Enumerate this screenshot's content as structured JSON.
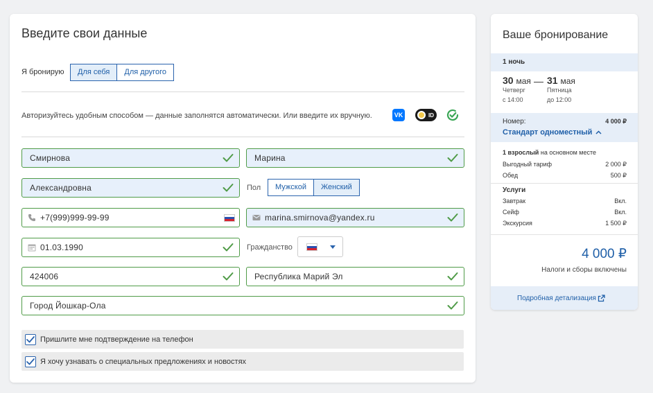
{
  "form": {
    "title": "Введите свои данные",
    "booking_for_label": "Я бронирую",
    "booking_for_options": [
      "Для себя",
      "Для другого"
    ],
    "booking_for_selected": "Для себя",
    "auth_text": "Авторизуйтесь удобным способом — данные заполнятся автоматически. Или введите их вручную.",
    "auth_providers": {
      "vk_label": "VK",
      "id_label": "ID"
    },
    "last_name": "Смирнова",
    "first_name": "Марина",
    "middle_name": "Александровна",
    "gender_label": "Пол",
    "gender_options": [
      "Мужской",
      "Женский"
    ],
    "gender_selected": "Женский",
    "phone": "+7(999)999-99-99",
    "email": "marina.smirnova@yandex.ru",
    "birth_date": "01.03.1990",
    "citizenship_label": "Гражданство",
    "postal_code": "424006",
    "region": "Республика Марий Эл",
    "city": "Город Йошкар-Ола",
    "checkbox_phone_confirm": "Пришлите мне подтверждение на телефон",
    "checkbox_offers": "Я хочу узнавать о специальных предложениях и новостях",
    "checkbox_phone_confirm_checked": true,
    "checkbox_offers_checked": true
  },
  "booking": {
    "title": "Ваше бронирование",
    "nights": "1 ночь",
    "checkin_day": "30",
    "checkin_month": "мая",
    "checkin_weekday": "Четверг",
    "checkin_time": "с 14:00",
    "checkout_day": "31",
    "checkout_month": "мая",
    "checkout_weekday": "Пятница",
    "checkout_time": "до 12:00",
    "date_separator": "—",
    "room_label": "Номер:",
    "room_price": "4 000 ₽",
    "room_name": "Стандарт одноместный",
    "guests_bold": "1 взрослый",
    "guests_rest": "на основном месте",
    "tariff_label": "Выгодный тариф",
    "tariff_price": "2 000 ₽",
    "lunch_label": "Обед",
    "lunch_price": "500 ₽",
    "services_title": "Услуги",
    "services": [
      {
        "label": "Завтрак",
        "value": "Вкл."
      },
      {
        "label": "Сейф",
        "value": "Вкл."
      },
      {
        "label": "Экскурсия",
        "value": "1 500 ₽"
      }
    ],
    "total": "4 000 ₽",
    "taxes_note": "Налоги и сборы включены",
    "details_link": "Подробная детализация"
  },
  "colors": {
    "accent": "#1f5fa8",
    "valid": "#4f9b47",
    "filled_bg": "#e7f0fb",
    "band_bg": "#e6eef8"
  },
  "icons": [
    "phone-icon",
    "mail-icon",
    "calendar-icon",
    "check-icon",
    "flag-ru-icon",
    "vk-icon",
    "id-icon",
    "gosuslugi-icon",
    "chevron-up-icon",
    "external-link-icon"
  ]
}
